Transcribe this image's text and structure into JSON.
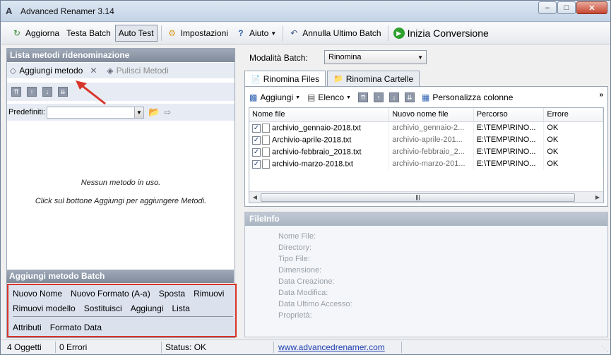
{
  "window": {
    "title": "Advanced Renamer 3.14"
  },
  "toolbar": {
    "refresh": "Aggiorna",
    "test_batch": "Testa Batch",
    "auto_test": "Auto Test",
    "settings": "Impostazioni",
    "help": "Aiuto",
    "undo": "Annulla Ultimo Batch",
    "start": "Inizia Conversione"
  },
  "left": {
    "header": "Lista metodi ridenominazione",
    "add_method": "Aggiungi metodo",
    "clear_methods": "Pulisci Metodi",
    "presets_label": "Predefiniti:",
    "presets_value": "",
    "empty_line1": "Nessun metodo in uso.",
    "empty_line2": "Click sul bottone Aggiungi per aggiungere Metodi."
  },
  "batch": {
    "header": "Aggiungi metodo Batch",
    "row1": [
      "Nuovo Nome",
      "Nuovo Formato (A-a)",
      "Sposta",
      "Rimuovi"
    ],
    "row2": [
      "Rimuovi modello",
      "Sostituisci",
      "Aggiungi",
      "Lista"
    ],
    "row3": [
      "Attributi",
      "Formato Data"
    ]
  },
  "right": {
    "batch_mode_label": "Modalità Batch:",
    "batch_mode_value": "Rinomina",
    "tabs": [
      "Rinomina Files",
      "Rinomina Cartelle"
    ],
    "file_toolbar": {
      "add": "Aggiungi",
      "list": "Elenco",
      "customize": "Personalizza colonne"
    },
    "columns": [
      "Nome file",
      "Nuovo nome file",
      "Percorso",
      "Errore"
    ],
    "rows": [
      {
        "name": "archivio_gennaio-2018.txt",
        "new": "archivio_gennaio-2...",
        "path": "E:\\TEMP\\RINO...",
        "err": "OK"
      },
      {
        "name": "Archivio-aprile-2018.txt",
        "new": "archivio-aprile-201...",
        "path": "E:\\TEMP\\RINO...",
        "err": "OK"
      },
      {
        "name": "archivio-febbraio_2018.txt",
        "new": "archivio-febbraio_2...",
        "path": "E:\\TEMP\\RINO...",
        "err": "OK"
      },
      {
        "name": "archivio-marzo-2018.txt",
        "new": "archivio-marzo-201...",
        "path": "E:\\TEMP\\RINO...",
        "err": "OK"
      }
    ]
  },
  "fileinfo": {
    "header": "FileInfo",
    "fields": [
      "Nome File:",
      "Directory:",
      "Tipo File:",
      "Dimensione:",
      "Data Creazione:",
      "Data Modifica:",
      "Data Ultimo Accesso:",
      "Proprietà:"
    ]
  },
  "status": {
    "objects": "4 Oggetti",
    "errors": "0 Errori",
    "status": "Status: OK",
    "link": "www.advancedrenamer.com"
  },
  "colors": {
    "highlight_red": "#d8352a",
    "header_gray": "#8a94a3"
  }
}
